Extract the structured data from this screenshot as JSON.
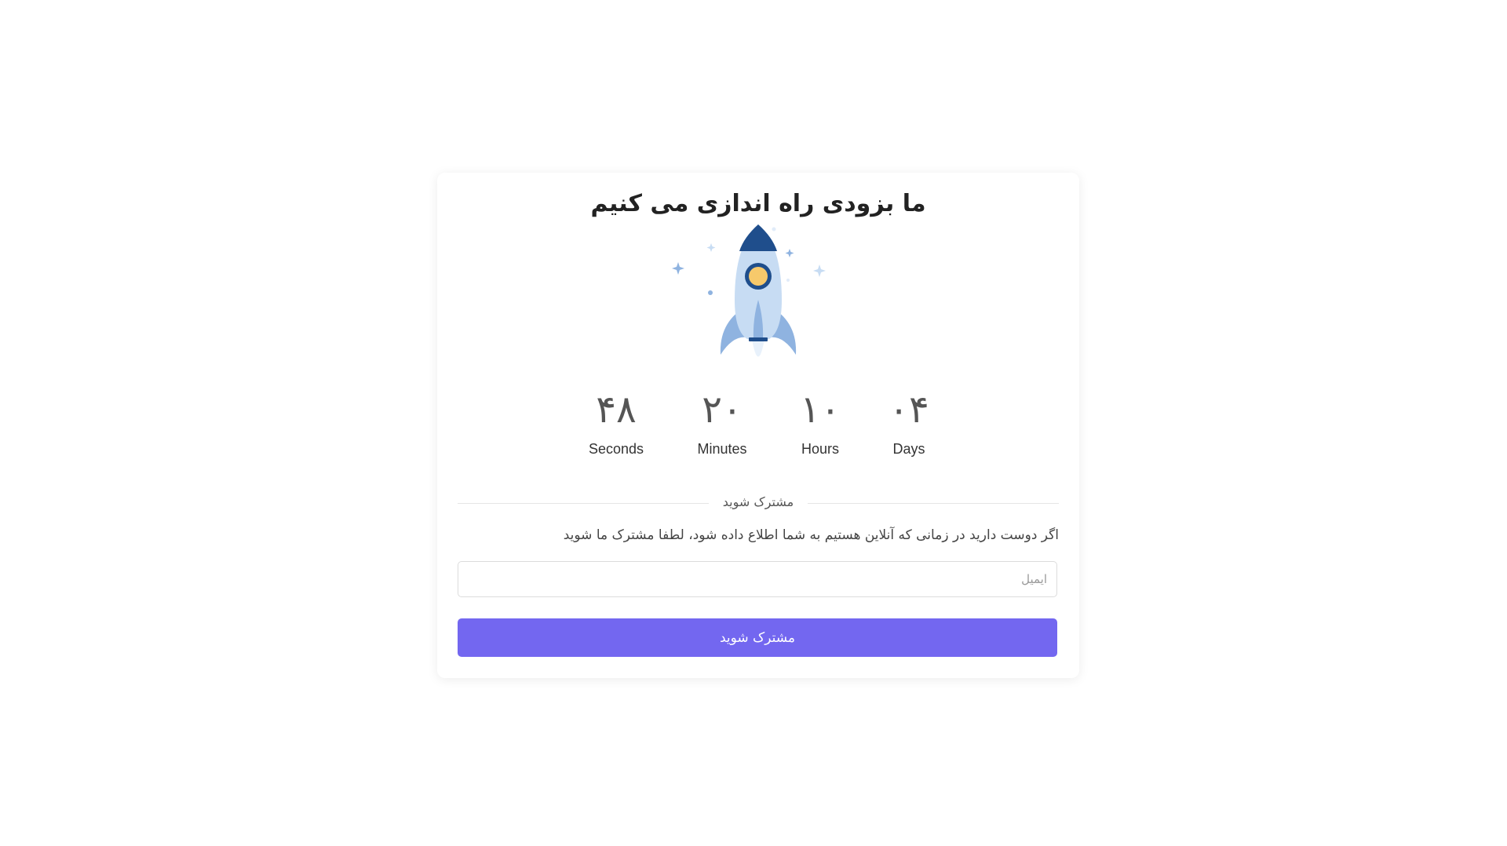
{
  "title": "ما بزودی راه اندازی می کنیم",
  "countdown": {
    "seconds": {
      "value": "۴۸",
      "label": "Seconds"
    },
    "minutes": {
      "value": "۲۰",
      "label": "Minutes"
    },
    "hours": {
      "value": "۱۰",
      "label": "Hours"
    },
    "days": {
      "value": "۰۴",
      "label": "Days"
    }
  },
  "subscribe": {
    "divider_text": "مشترک شوید",
    "description": "اگر دوست دارید در زمانی که آنلاین هستیم به شما اطلاع داده شود، لطفا مشترک ما شوید",
    "email_placeholder": "ایمیل",
    "email_value": "",
    "button_label": "مشترک شوید"
  },
  "colors": {
    "accent": "#7367f0",
    "rocket_dark": "#1f4e8c",
    "rocket_light": "#c7dcf3",
    "rocket_wing": "#8fb3e0",
    "window": "#f7c96b"
  },
  "icons": {
    "illustration": "rocket-illustration"
  }
}
